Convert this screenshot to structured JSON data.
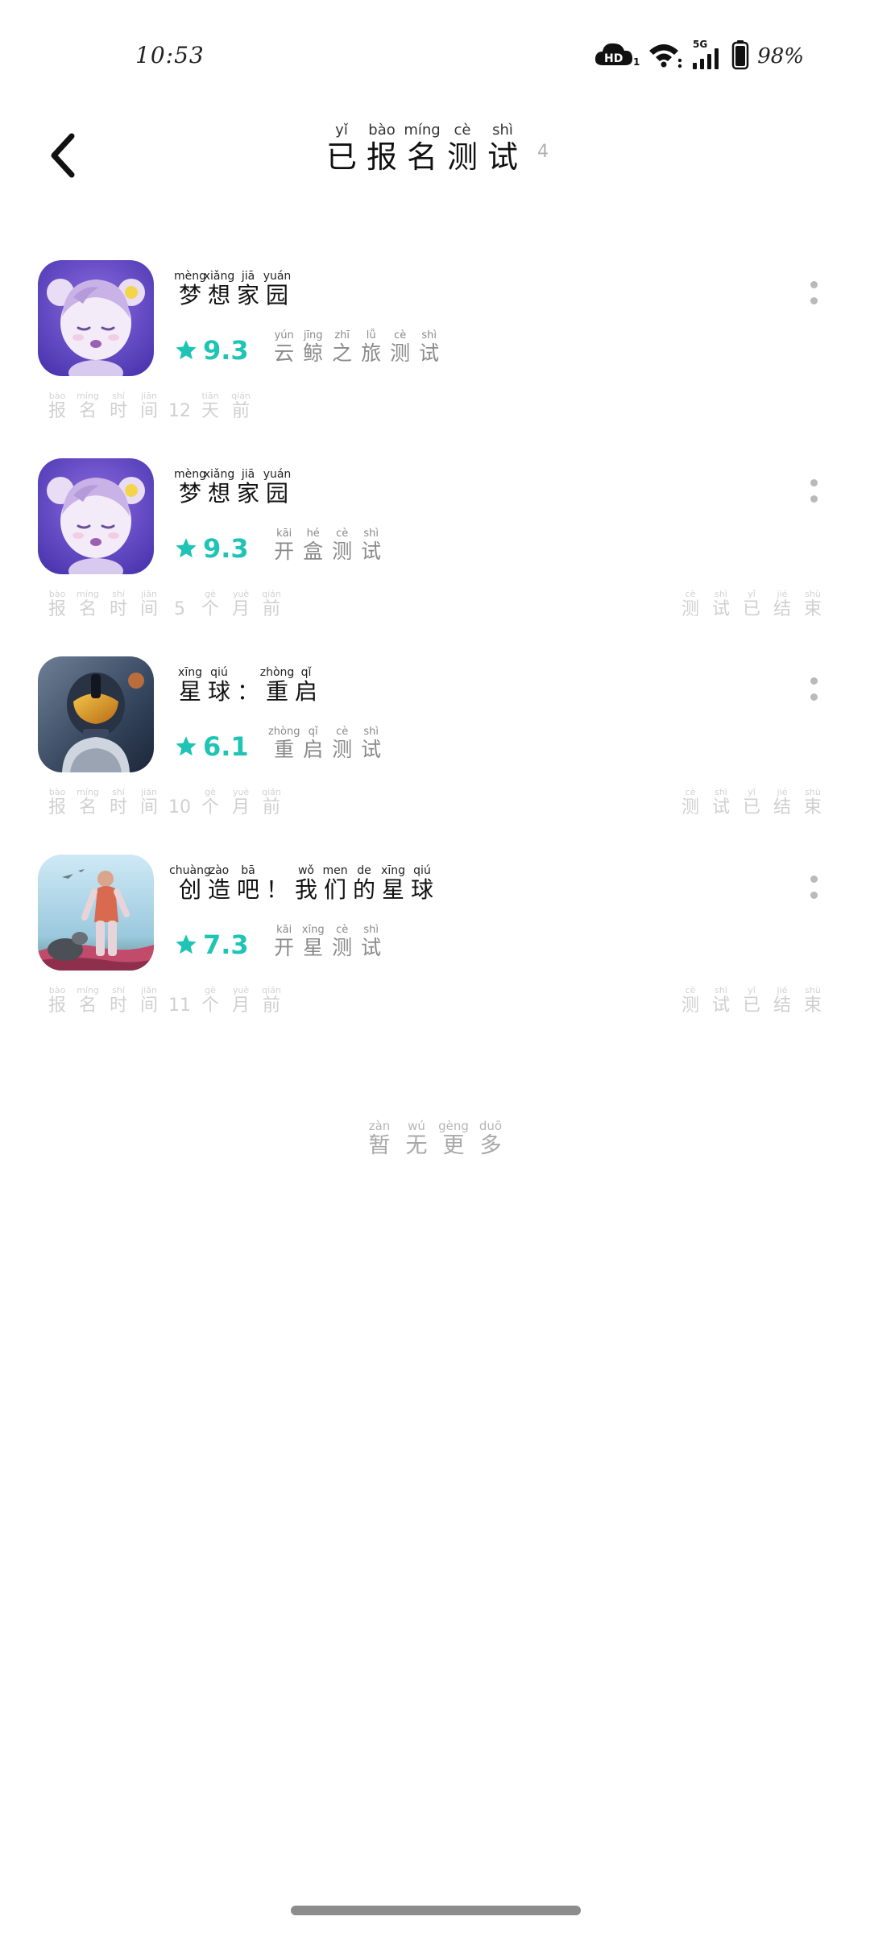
{
  "status_bar": {
    "time": "10:53",
    "battery": "98%",
    "hd_badge": "HD",
    "hd_sub": "1",
    "network": "5G",
    "icons": [
      "cloud-hd-icon",
      "wifi-icon",
      "signal-icon",
      "battery-icon"
    ]
  },
  "header": {
    "back_icon": "chevron-left-icon",
    "title": [
      {
        "py": "yǐ",
        "hz": "已"
      },
      {
        "py": "bào",
        "hz": "报"
      },
      {
        "py": "míng",
        "hz": "名"
      },
      {
        "py": "cè",
        "hz": "测"
      },
      {
        "py": "shì",
        "hz": "试"
      }
    ],
    "count": "4"
  },
  "items": [
    {
      "icon": "dream-home-doll-icon",
      "name": [
        {
          "py": "mèng",
          "hz": "梦"
        },
        {
          "py": "xiǎng",
          "hz": "想"
        },
        {
          "py": "jiā",
          "hz": "家"
        },
        {
          "py": "yuán",
          "hz": "园"
        }
      ],
      "rating": "9.3",
      "test": [
        {
          "py": "yún",
          "hz": "云"
        },
        {
          "py": "jīng",
          "hz": "鲸"
        },
        {
          "py": "zhī",
          "hz": "之"
        },
        {
          "py": "lǚ",
          "hz": "旅"
        },
        {
          "py": "cè",
          "hz": "测"
        },
        {
          "py": "shì",
          "hz": "试"
        }
      ],
      "signup": [
        {
          "py": "bào",
          "hz": "报"
        },
        {
          "py": "míng",
          "hz": "名"
        },
        {
          "py": "shí",
          "hz": "时"
        },
        {
          "py": "jiān",
          "hz": "间"
        },
        {
          "py": "",
          "hz": "12"
        },
        {
          "py": "tiān",
          "hz": "天"
        },
        {
          "py": "qián",
          "hz": "前"
        }
      ],
      "status": []
    },
    {
      "icon": "dream-home-doll-icon",
      "name": [
        {
          "py": "mèng",
          "hz": "梦"
        },
        {
          "py": "xiǎng",
          "hz": "想"
        },
        {
          "py": "jiā",
          "hz": "家"
        },
        {
          "py": "yuán",
          "hz": "园"
        }
      ],
      "rating": "9.3",
      "test": [
        {
          "py": "kāi",
          "hz": "开"
        },
        {
          "py": "hé",
          "hz": "盒"
        },
        {
          "py": "cè",
          "hz": "测"
        },
        {
          "py": "shì",
          "hz": "试"
        }
      ],
      "signup": [
        {
          "py": "bào",
          "hz": "报"
        },
        {
          "py": "míng",
          "hz": "名"
        },
        {
          "py": "shí",
          "hz": "时"
        },
        {
          "py": "jiān",
          "hz": "间"
        },
        {
          "py": "",
          "hz": "5"
        },
        {
          "py": "gè",
          "hz": "个"
        },
        {
          "py": "yuè",
          "hz": "月"
        },
        {
          "py": "qián",
          "hz": "前"
        }
      ],
      "status": [
        {
          "py": "cè",
          "hz": "测"
        },
        {
          "py": "shì",
          "hz": "试"
        },
        {
          "py": "yǐ",
          "hz": "已"
        },
        {
          "py": "jié",
          "hz": "结"
        },
        {
          "py": "shù",
          "hz": "束"
        }
      ]
    },
    {
      "icon": "astronaut-helmet-icon",
      "name": [
        {
          "py": "xīng",
          "hz": "星"
        },
        {
          "py": "qiú",
          "hz": "球"
        },
        {
          "py": "",
          "hz": "："
        },
        {
          "py": "zhòng",
          "hz": "重"
        },
        {
          "py": "qǐ",
          "hz": "启"
        }
      ],
      "rating": "6.1",
      "test": [
        {
          "py": "zhòng",
          "hz": "重"
        },
        {
          "py": "qǐ",
          "hz": "启"
        },
        {
          "py": "cè",
          "hz": "测"
        },
        {
          "py": "shì",
          "hz": "试"
        }
      ],
      "signup": [
        {
          "py": "bào",
          "hz": "报"
        },
        {
          "py": "míng",
          "hz": "名"
        },
        {
          "py": "shí",
          "hz": "时"
        },
        {
          "py": "jiān",
          "hz": "间"
        },
        {
          "py": "",
          "hz": "10"
        },
        {
          "py": "gè",
          "hz": "个"
        },
        {
          "py": "yuè",
          "hz": "月"
        },
        {
          "py": "qián",
          "hz": "前"
        }
      ],
      "status": [
        {
          "py": "cè",
          "hz": "测"
        },
        {
          "py": "shì",
          "hz": "试"
        },
        {
          "py": "yǐ",
          "hz": "已"
        },
        {
          "py": "jié",
          "hz": "结"
        },
        {
          "py": "shù",
          "hz": "束"
        }
      ]
    },
    {
      "icon": "space-explorer-icon",
      "name": [
        {
          "py": "chuàng",
          "hz": "创"
        },
        {
          "py": "zào",
          "hz": "造"
        },
        {
          "py": "bā",
          "hz": "吧"
        },
        {
          "py": "",
          "hz": "！"
        },
        {
          "py": "wǒ",
          "hz": "我"
        },
        {
          "py": "men",
          "hz": "们"
        },
        {
          "py": "de",
          "hz": "的"
        },
        {
          "py": "xīng",
          "hz": "星"
        },
        {
          "py": "qiú",
          "hz": "球"
        }
      ],
      "rating": "7.3",
      "test": [
        {
          "py": "kāi",
          "hz": "开"
        },
        {
          "py": "xīng",
          "hz": "星"
        },
        {
          "py": "cè",
          "hz": "测"
        },
        {
          "py": "shì",
          "hz": "试"
        }
      ],
      "signup": [
        {
          "py": "bào",
          "hz": "报"
        },
        {
          "py": "míng",
          "hz": "名"
        },
        {
          "py": "shí",
          "hz": "时"
        },
        {
          "py": "jiān",
          "hz": "间"
        },
        {
          "py": "",
          "hz": "11"
        },
        {
          "py": "gè",
          "hz": "个"
        },
        {
          "py": "yuè",
          "hz": "月"
        },
        {
          "py": "qián",
          "hz": "前"
        }
      ],
      "status": [
        {
          "py": "cè",
          "hz": "测"
        },
        {
          "py": "shì",
          "hz": "试"
        },
        {
          "py": "yǐ",
          "hz": "已"
        },
        {
          "py": "jié",
          "hz": "结"
        },
        {
          "py": "shù",
          "hz": "束"
        }
      ]
    }
  ],
  "footer": {
    "no_more": [
      {
        "py": "zàn",
        "hz": "暂"
      },
      {
        "py": "wú",
        "hz": "无"
      },
      {
        "py": "gèng",
        "hz": "更"
      },
      {
        "py": "duō",
        "hz": "多"
      }
    ]
  },
  "colors": {
    "rating": "#1fc4b5",
    "secondary_text": "#8a8a8a",
    "meta_text": "#d0d0d0",
    "more_dots": "#b9b9b9",
    "home_indicator": "#8c8c8c"
  }
}
